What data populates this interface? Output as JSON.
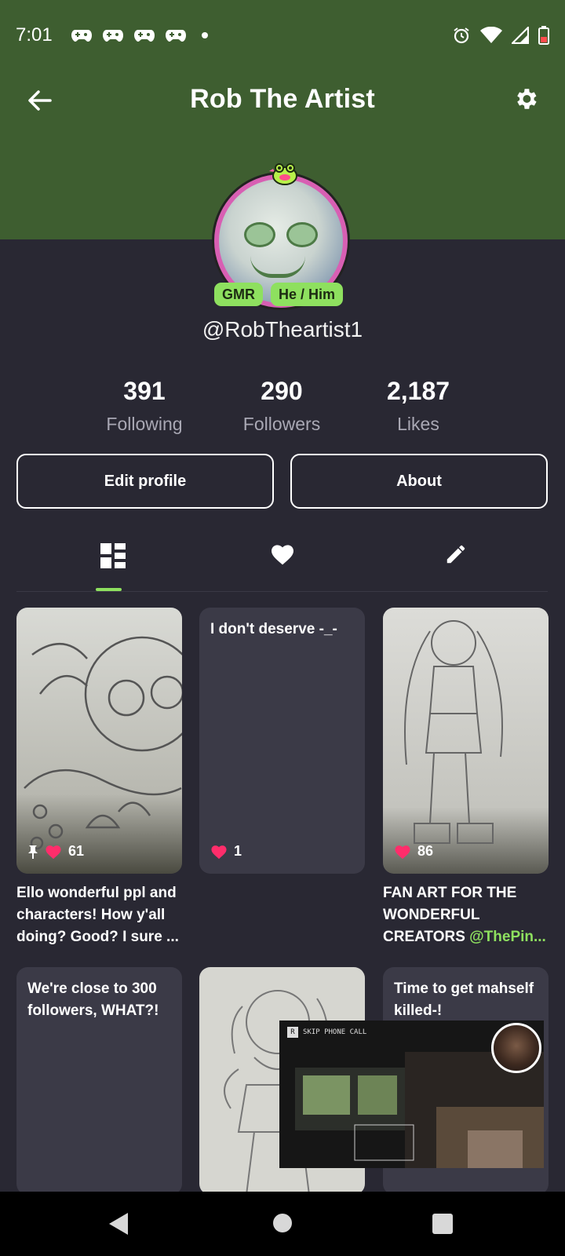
{
  "status_bar": {
    "time": "7:01",
    "left_icons": [
      "game-controller-icon",
      "game-controller-icon",
      "game-controller-icon",
      "game-controller-icon"
    ],
    "right_icons": [
      "alarm-icon",
      "wifi-icon",
      "signal-icon",
      "battery-icon"
    ]
  },
  "header": {
    "title": "Rob The Artist",
    "back_icon": "arrow-left-icon",
    "settings_icon": "gear-icon"
  },
  "profile": {
    "tags": [
      "GMR",
      "He / Him"
    ],
    "handle": "@RobTheartist1"
  },
  "stats": [
    {
      "value": "391",
      "label": "Following"
    },
    {
      "value": "290",
      "label": "Followers"
    },
    {
      "value": "2,187",
      "label": "Likes"
    }
  ],
  "buttons": {
    "edit": "Edit profile",
    "about": "About"
  },
  "tabs": [
    "grid-icon",
    "heart-icon",
    "pencil-icon"
  ],
  "posts": [
    {
      "type": "image",
      "likes": "61",
      "pinned": true,
      "caption": "Ello wonderful ppl and characters! How y'all doing? Good? I sure ..."
    },
    {
      "type": "text",
      "text": "I don't deserve -_-",
      "likes": "1"
    },
    {
      "type": "image",
      "likes": "86",
      "caption_prefix": "FAN ART FOR THE WONDERFUL CREATORS ",
      "caption_mention": "@ThePin..."
    },
    {
      "type": "text",
      "text": "We're close to 300 followers, WHAT?!"
    },
    {
      "type": "image"
    },
    {
      "type": "text",
      "text": "Time to get mahself killed-!"
    }
  ],
  "pip": {
    "skip_key": "R",
    "skip_label": "SKIP PHONE CALL"
  },
  "colors": {
    "header_green": "#3e5e30",
    "background": "#292833",
    "card": "#3b3a47",
    "accent_green": "#8ee05f",
    "heart_pink": "#ff2d6b"
  }
}
